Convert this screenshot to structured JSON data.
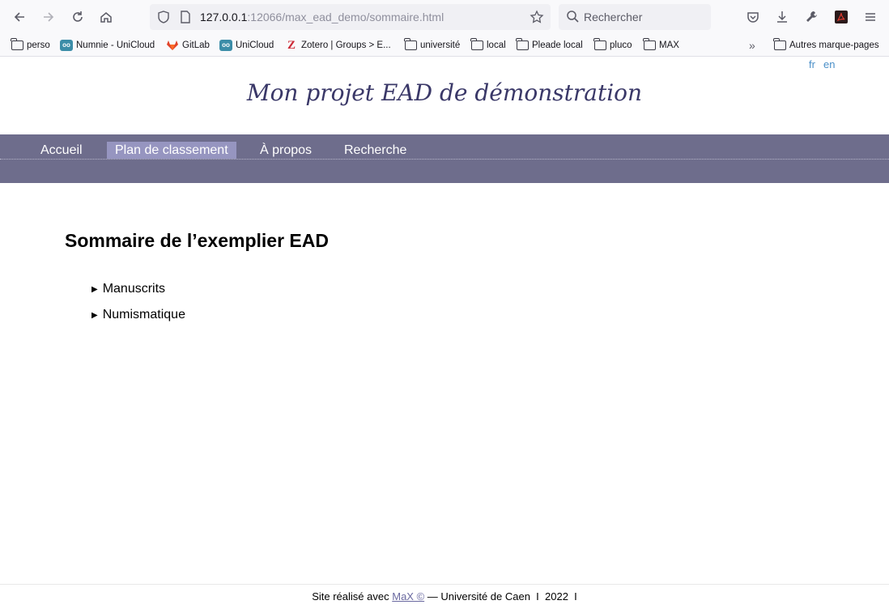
{
  "browser": {
    "url_host": "127.0.0.1",
    "url_rest": ":12066/max_ead_demo/sommaire.html",
    "search_placeholder": "Rechercher"
  },
  "bookmarks": [
    {
      "label": "perso",
      "icon": "folder-icon"
    },
    {
      "label": "Numnie - UniCloud",
      "icon": "nextcloud-icon"
    },
    {
      "label": "GitLab",
      "icon": "gitlab-icon"
    },
    {
      "label": "UniCloud",
      "icon": "nextcloud-icon"
    },
    {
      "label": "Zotero | Groups > E...",
      "icon": "zotero-icon"
    },
    {
      "label": "université",
      "icon": "folder-icon"
    },
    {
      "label": "local",
      "icon": "folder-icon"
    },
    {
      "label": "Pleade local",
      "icon": "folder-icon"
    },
    {
      "label": "pluco",
      "icon": "folder-icon"
    },
    {
      "label": "MAX",
      "icon": "folder-icon"
    },
    {
      "label": "Autres marque-pages",
      "icon": "folder-icon"
    }
  ],
  "lang": {
    "fr": "fr",
    "en": "en"
  },
  "site_title": "Mon projet EAD de démonstration",
  "nav": {
    "home": "Accueil",
    "plan": "Plan de classement",
    "about": "À propos",
    "search": "Recherche"
  },
  "main": {
    "heading": "Sommaire de l’exemplier EAD",
    "items": [
      "Manuscrits",
      "Numismatique"
    ]
  },
  "footer": {
    "prefix": "Site réalisé avec",
    "link": "MaX ©",
    "suffix": "— Université de Caen  I  2022  I"
  }
}
